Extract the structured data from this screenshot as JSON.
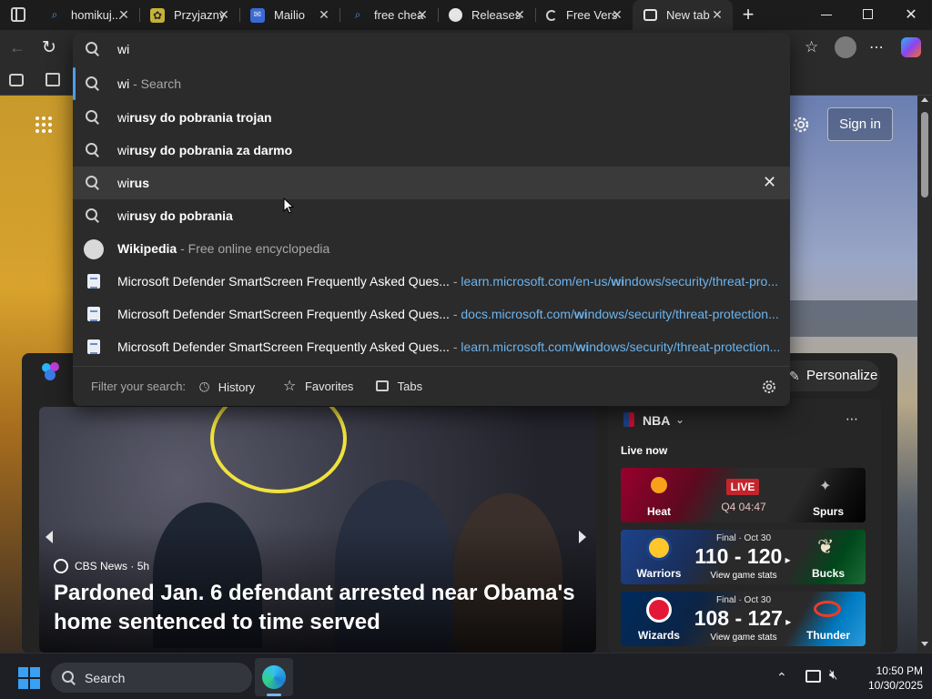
{
  "tabs": [
    {
      "title": "homikuj...",
      "icon": "search-icon"
    },
    {
      "title": "Przyjazny",
      "icon": "puzzle-icon"
    },
    {
      "title": "Mailio",
      "icon": "mail-icon"
    },
    {
      "title": "free chea",
      "icon": "search-icon"
    },
    {
      "title": "Releases",
      "icon": "github-icon"
    },
    {
      "title": "Free Vers",
      "icon": "loading-icon"
    },
    {
      "title": "New tab",
      "icon": "newtab-icon"
    }
  ],
  "omnibox": {
    "query": "wi",
    "suggestions": [
      {
        "bold": "wi",
        "rest": "",
        "suffix": " - Search",
        "type": "search"
      },
      {
        "bold": "wi",
        "rest": "rusy do pobrania trojan",
        "suffix": "",
        "type": "search"
      },
      {
        "bold": "wi",
        "rest": "rusy do pobrania za darmo",
        "suffix": "",
        "type": "search"
      },
      {
        "bold": "wi",
        "rest": "rus",
        "suffix": "",
        "type": "search"
      },
      {
        "bold": "wi",
        "rest": "rusy do pobrania",
        "suffix": "",
        "type": "search"
      },
      {
        "bold": "Wikipedia",
        "rest": "",
        "suffix": " - Free online encyclopedia",
        "type": "site"
      },
      {
        "title": "Microsoft Defender SmartScreen Frequently Asked Ques...",
        "url_pre": "learn.microsoft.com/en-us/",
        "url_bold": "wi",
        "url_post": "ndows/security/threat-pro...",
        "type": "history"
      },
      {
        "title": "Microsoft Defender SmartScreen Frequently Asked Ques...",
        "url_pre": "docs.microsoft.com/",
        "url_bold": "wi",
        "url_post": "ndows/security/threat-protection...",
        "type": "history"
      },
      {
        "title": "Microsoft Defender SmartScreen Frequently Asked Ques...",
        "url_pre": "learn.microsoft.com/",
        "url_bold": "wi",
        "url_post": "ndows/security/threat-protection...",
        "type": "history"
      }
    ],
    "filter_label": "Filter your search:",
    "filters": [
      "History",
      "Favorites",
      "Tabs"
    ]
  },
  "page": {
    "sign_in": "Sign in",
    "personalize": "Personalize",
    "news": {
      "source": "CBS News",
      "age": "5h",
      "headline_line1": "Pardoned Jan. 6 defendant arrested near Obama's",
      "headline_line2": "home sentenced to time served"
    },
    "nba": {
      "title": "NBA",
      "live_label": "Live now",
      "games": [
        {
          "home": "Heat",
          "away": "Spurs",
          "status": "LIVE",
          "clock": "Q4 04:47",
          "home_color": "#98002e",
          "away_color": "#111111"
        },
        {
          "home": "Warriors",
          "away": "Bucks",
          "status": "Final · Oct 30",
          "score": "110 - 120",
          "link": "View game stats",
          "home_color": "#1d428a",
          "away_color": "#00471b"
        },
        {
          "home": "Wizards",
          "away": "Thunder",
          "status": "Final · Oct 30",
          "score": "108 - 127",
          "link": "View game stats",
          "home_color": "#002b5c",
          "away_color": "#007ac1"
        }
      ]
    }
  },
  "taskbar": {
    "search_label": "Search",
    "time": "10:50 PM",
    "date": "10/30/2025"
  }
}
